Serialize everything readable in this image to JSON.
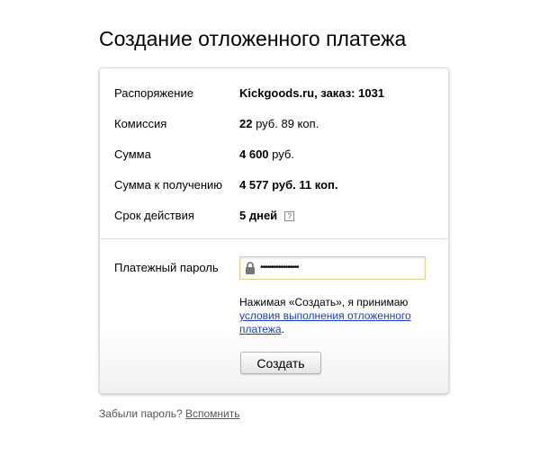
{
  "title": "Создание отложенного платежа",
  "details": [
    {
      "label": "Распоряжение",
      "value_bold": "Kickgoods.ru, заказ: 1031",
      "value_rest": ""
    },
    {
      "label": "Комиссия",
      "value_bold": "22",
      "value_rest": " руб. 89 коп."
    },
    {
      "label": "Сумма",
      "value_bold": "4 600",
      "value_rest": " руб."
    },
    {
      "label": "Сумма к получению",
      "value_bold": "4 577 руб. 11 коп.",
      "value_rest": ""
    },
    {
      "label": "Срок действия",
      "value_bold": "5 дней",
      "value_rest": "",
      "help": "?"
    }
  ],
  "password": {
    "label": "Платежный пароль",
    "value": "•••••••••••••••••",
    "icon": "lock-icon"
  },
  "agreement": {
    "text": "Нажимая «Создать», я принимаю ",
    "link": "условия выполнения отложенного платежа",
    "suffix": "."
  },
  "submit_label": "Создать",
  "footer": {
    "text": "Забыли пароль? ",
    "link": "Вспомнить"
  }
}
